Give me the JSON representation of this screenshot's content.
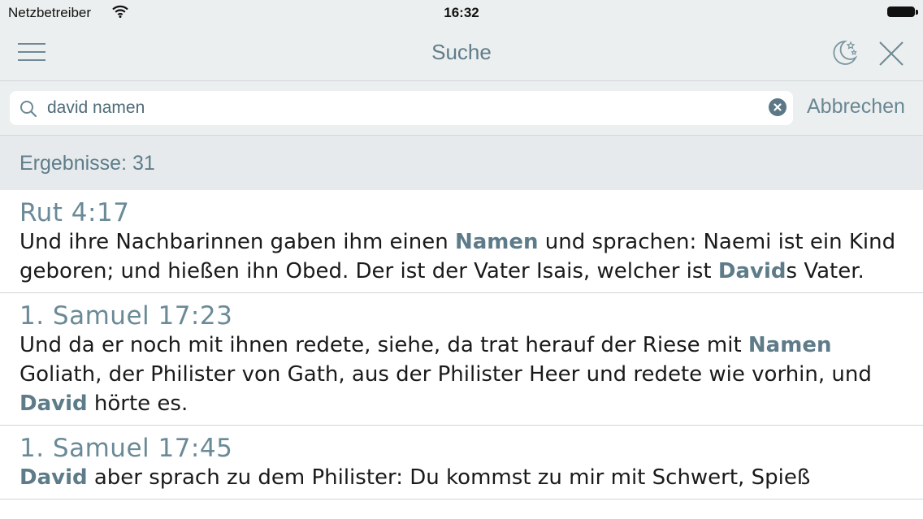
{
  "status_bar": {
    "carrier": "Netzbetreiber",
    "time": "16:32"
  },
  "nav": {
    "title": "Suche"
  },
  "search": {
    "value": "david namen",
    "cancel_label": "Abbrechen"
  },
  "results_header": {
    "label": "Ergebnisse: 31"
  },
  "results": [
    {
      "reference": "Rut 4:17",
      "segments": [
        {
          "t": "Und ihre Nachbarinnen gaben ihm einen ",
          "h": false
        },
        {
          "t": "Namen",
          "h": true
        },
        {
          "t": " und sprachen: Naemi ist ein Kind geboren; und hießen ihn Obed. Der ist der Vater Isais, welcher ist ",
          "h": false
        },
        {
          "t": "David",
          "h": true
        },
        {
          "t": "s Vater.",
          "h": false
        }
      ]
    },
    {
      "reference": "1. Samuel 17:23",
      "segments": [
        {
          "t": "Und da er noch mit ihnen redete, siehe, da trat herauf der Riese mit ",
          "h": false
        },
        {
          "t": "Namen",
          "h": true
        },
        {
          "t": " Goliath, der Philister von Gath, aus der Philister Heer und redete wie vorhin, und ",
          "h": false
        },
        {
          "t": "David",
          "h": true
        },
        {
          "t": " hörte es.",
          "h": false
        }
      ]
    },
    {
      "reference": "1. Samuel 17:45",
      "segments": [
        {
          "t": "David",
          "h": true
        },
        {
          "t": " aber sprach zu dem Philister: Du kommst zu mir mit Schwert, Spieß",
          "h": false
        }
      ]
    }
  ],
  "colors": {
    "accent": "#5d7b88",
    "bar": "#ecefef",
    "header": "#e6eaec"
  }
}
